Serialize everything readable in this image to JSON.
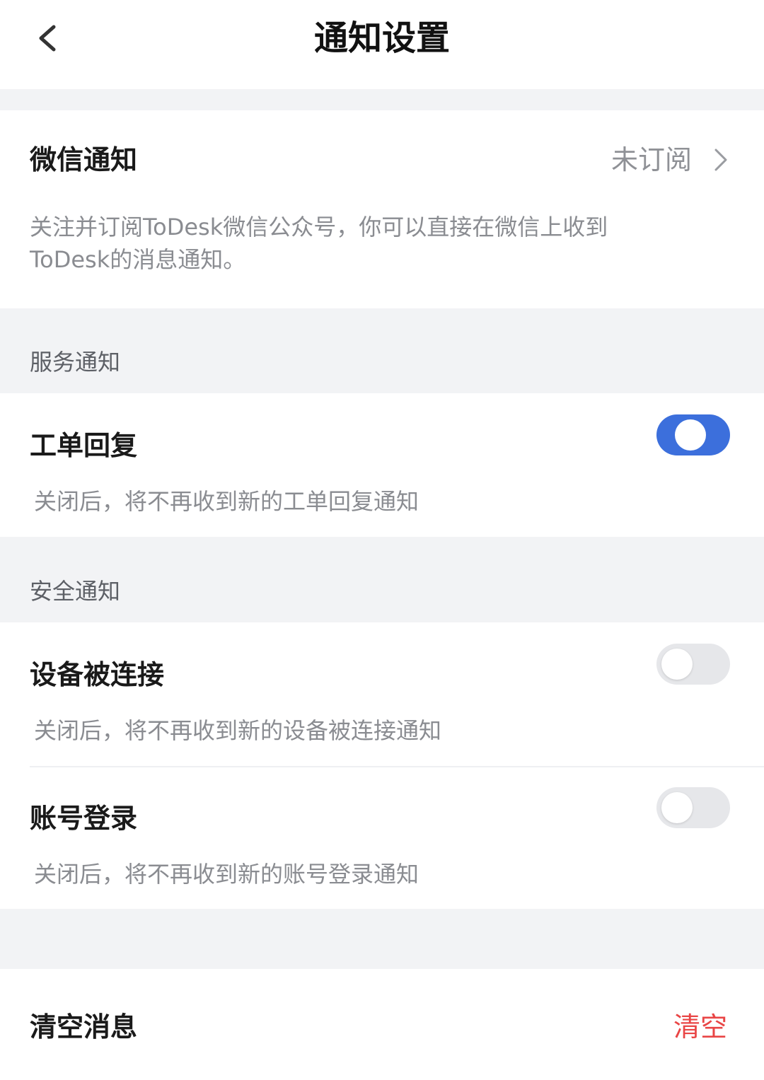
{
  "header": {
    "back_icon": "chevron-left-icon",
    "title": "通知设置"
  },
  "wechat": {
    "title": "微信通知",
    "status": "未订阅",
    "chevron_icon": "chevron-right-icon",
    "description": "关注并订阅ToDesk微信公众号，你可以直接在微信上收到ToDesk的消息通知。"
  },
  "service_section": {
    "title": "服务通知",
    "items": [
      {
        "title": "工单回复",
        "description": "关闭后，将不再收到新的工单回复通知",
        "enabled": true
      }
    ]
  },
  "security_section": {
    "title": "安全通知",
    "items": [
      {
        "title": "设备被连接",
        "description": "关闭后，将不再收到新的设备被连接通知",
        "enabled": false
      },
      {
        "title": "账号登录",
        "description": "关闭后，将不再收到新的账号登录通知",
        "enabled": false
      }
    ]
  },
  "clear": {
    "title": "清空消息",
    "action_label": "清空"
  },
  "colors": {
    "accent": "#3c6fdc",
    "danger": "#e94545",
    "background": "#f2f3f5"
  }
}
